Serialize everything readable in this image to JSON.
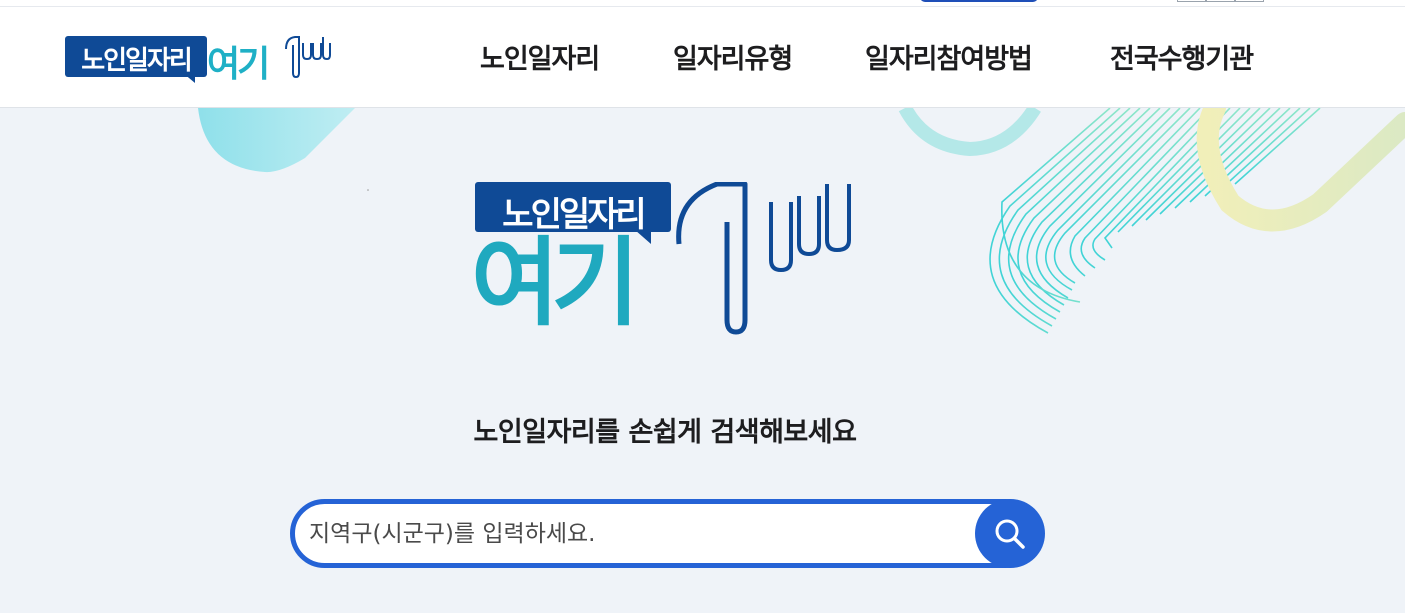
{
  "brand": {
    "logo_box_text": "노인일자리",
    "logo_word": "여기"
  },
  "nav": {
    "items": [
      {
        "label": "노인일자리"
      },
      {
        "label": "일자리유형"
      },
      {
        "label": "일자리참여방법"
      },
      {
        "label": "전국수행기관"
      }
    ]
  },
  "hero": {
    "subtitle": "노인일자리를 손쉽게 검색해보세요",
    "search": {
      "placeholder": "지역구(시군구)를 입력하세요.",
      "value": ""
    }
  },
  "icons": {
    "search": "search-icon"
  },
  "colors": {
    "brand_navy": "#0f4a96",
    "brand_teal": "#1fa9bf",
    "accent_blue": "#2563d6",
    "hero_bg": "#eff3f8"
  }
}
